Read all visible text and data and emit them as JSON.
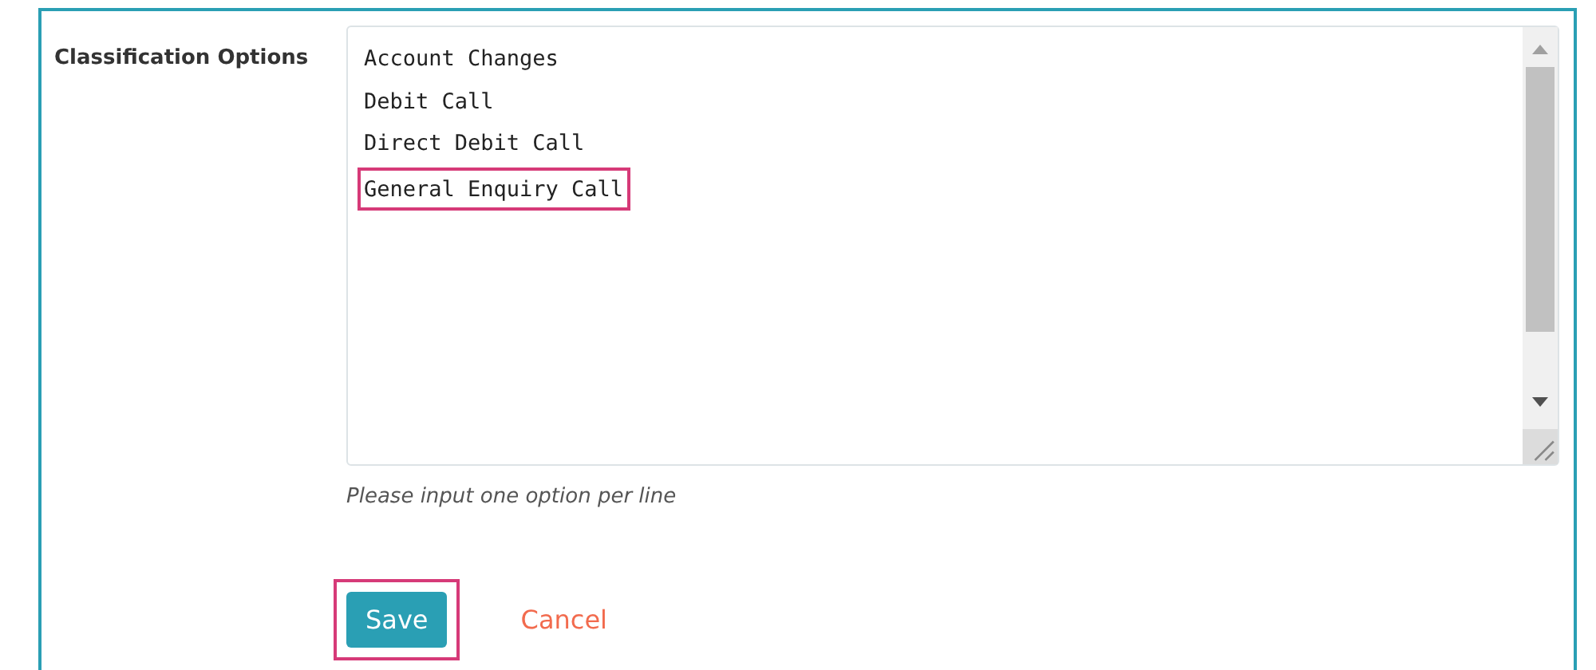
{
  "field": {
    "label": "Classification Options",
    "lines": [
      {
        "text": "Account Changes",
        "highlighted": false
      },
      {
        "text": "Debit Call",
        "highlighted": false
      },
      {
        "text": "Direct Debit Call",
        "highlighted": false
      },
      {
        "text": "General Enquiry Call",
        "highlighted": true
      }
    ],
    "help": "Please input one option per line"
  },
  "buttons": [
    {
      "kind": "primary",
      "label": "Save",
      "highlighted": true
    },
    {
      "kind": "link",
      "label": "Cancel"
    }
  ]
}
